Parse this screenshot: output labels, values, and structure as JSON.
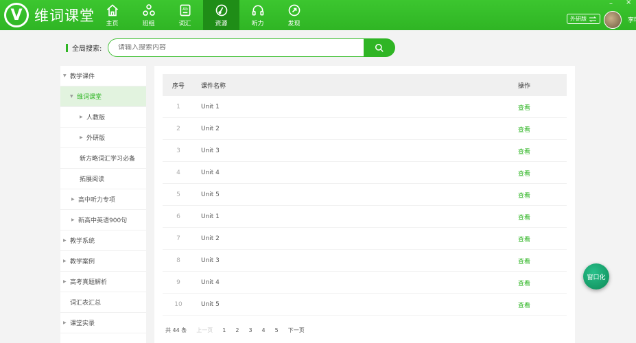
{
  "app": {
    "logo_letter": "V",
    "name": "维词课堂"
  },
  "nav": [
    {
      "label": "主页",
      "icon": "home-icon"
    },
    {
      "label": "班组",
      "icon": "group-icon"
    },
    {
      "label": "词汇",
      "icon": "vocabulary-icon"
    },
    {
      "label": "资源",
      "icon": "resource-icon",
      "active": true
    },
    {
      "label": "听力",
      "icon": "headphones-icon"
    },
    {
      "label": "发现",
      "icon": "discover-icon"
    }
  ],
  "header": {
    "edition": "外研版",
    "edition_icon": "swap-icon",
    "user": "李明",
    "win_min": "–",
    "win_close": "×"
  },
  "search": {
    "label": "全局搜索:",
    "placeholder": "请输入搜索内容"
  },
  "sidebar": [
    {
      "label": "教学课件",
      "arrow": "▼",
      "indent": 4
    },
    {
      "label": "维词课堂",
      "arrow": "▼",
      "indent": 14,
      "active": true
    },
    {
      "label": "人教版",
      "arrow": "▶",
      "indent": 28
    },
    {
      "label": "外研版",
      "arrow": "▶",
      "indent": 28
    },
    {
      "label": "新方略词汇学习必备",
      "arrow": "",
      "indent": 28
    },
    {
      "label": "拓展阅读",
      "arrow": "",
      "indent": 28
    },
    {
      "label": "高中听力专项",
      "arrow": "▶",
      "indent": 16
    },
    {
      "label": "新高中英语900句",
      "arrow": "▶",
      "indent": 16
    },
    {
      "label": "教学系统",
      "arrow": "▶",
      "indent": 4
    },
    {
      "label": "教学案例",
      "arrow": "▶",
      "indent": 4
    },
    {
      "label": "高考真题解析",
      "arrow": "▶",
      "indent": 4
    },
    {
      "label": "词汇表汇总",
      "arrow": "",
      "indent": 14
    },
    {
      "label": "课堂实录",
      "arrow": "▶",
      "indent": 4
    }
  ],
  "table": {
    "headers": {
      "no": "序号",
      "name": "课件名称",
      "op": "操作"
    },
    "rows": [
      {
        "no": "1",
        "name": "Unit 1",
        "op": "查看"
      },
      {
        "no": "2",
        "name": "Unit 2",
        "op": "查看"
      },
      {
        "no": "3",
        "name": "Unit 3",
        "op": "查看"
      },
      {
        "no": "4",
        "name": "Unit 4",
        "op": "查看"
      },
      {
        "no": "5",
        "name": "Unit 5",
        "op": "查看"
      },
      {
        "no": "6",
        "name": "Unit 1",
        "op": "查看"
      },
      {
        "no": "7",
        "name": "Unit 2",
        "op": "查看"
      },
      {
        "no": "8",
        "name": "Unit 3",
        "op": "查看"
      },
      {
        "no": "9",
        "name": "Unit 4",
        "op": "查看"
      },
      {
        "no": "10",
        "name": "Unit 5",
        "op": "查看"
      }
    ]
  },
  "pager": {
    "total": "共 44 条",
    "prev": "上一页",
    "pages": [
      "1",
      "2",
      "3",
      "4",
      "5"
    ],
    "next": "下一页"
  },
  "float_button": "窗口化",
  "colors": {
    "brand": "#2fb524",
    "nav_active": "#1f8d17",
    "sidebar_active_bg": "#e2f3df"
  }
}
